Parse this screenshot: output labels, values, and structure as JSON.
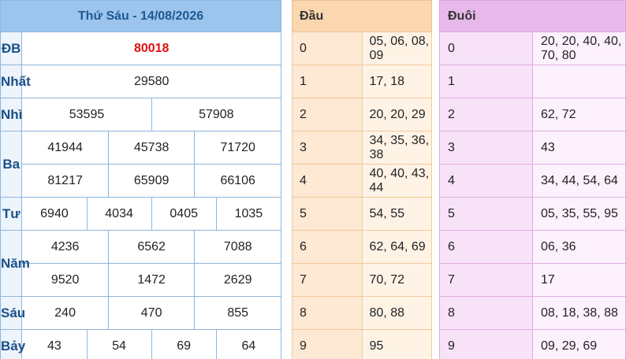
{
  "results": {
    "title": "Thứ Sáu - 14/08/2026",
    "prizes": {
      "db": {
        "label": "ĐB",
        "numbers": [
          "80018"
        ]
      },
      "nhat": {
        "label": "Nhất",
        "numbers": [
          "29580"
        ]
      },
      "nhi": {
        "label": "Nhì",
        "numbers": [
          "53595",
          "57908"
        ]
      },
      "ba": {
        "label": "Ba",
        "numbers": [
          "41944",
          "45738",
          "71720",
          "81217",
          "65909",
          "66106"
        ]
      },
      "tu": {
        "label": "Tư",
        "numbers": [
          "6940",
          "4034",
          "0405",
          "1035"
        ]
      },
      "nam": {
        "label": "Năm",
        "numbers": [
          "4236",
          "6562",
          "7088",
          "9520",
          "1472",
          "2629"
        ]
      },
      "sau": {
        "label": "Sáu",
        "numbers": [
          "240",
          "470",
          "855"
        ]
      },
      "bay": {
        "label": "Bảy",
        "numbers": [
          "43",
          "54",
          "69",
          "64"
        ]
      }
    }
  },
  "head": {
    "header": "Đầu",
    "rows": [
      {
        "key": "0",
        "values": "05, 06, 08, 09"
      },
      {
        "key": "1",
        "values": "17, 18"
      },
      {
        "key": "2",
        "values": "20, 20, 29"
      },
      {
        "key": "3",
        "values": "34, 35, 36, 38"
      },
      {
        "key": "4",
        "values": "40, 40, 43, 44"
      },
      {
        "key": "5",
        "values": "54, 55"
      },
      {
        "key": "6",
        "values": "62, 64, 69"
      },
      {
        "key": "7",
        "values": "70, 72"
      },
      {
        "key": "8",
        "values": "80, 88"
      },
      {
        "key": "9",
        "values": "95"
      }
    ]
  },
  "tail": {
    "header": "Đuôi",
    "rows": [
      {
        "key": "0",
        "values": "20, 20, 40, 40, 70, 80"
      },
      {
        "key": "1",
        "values": ""
      },
      {
        "key": "2",
        "values": "62, 72"
      },
      {
        "key": "3",
        "values": "43"
      },
      {
        "key": "4",
        "values": "34, 44, 54, 64"
      },
      {
        "key": "5",
        "values": "05, 35, 55, 95"
      },
      {
        "key": "6",
        "values": "06, 36"
      },
      {
        "key": "7",
        "values": "17"
      },
      {
        "key": "8",
        "values": "08, 18, 38, 88"
      },
      {
        "key": "9",
        "values": "09, 29, 69"
      }
    ]
  },
  "colors": {
    "special_prize": "#e01010",
    "results_header": "#9cc4ec",
    "head_header": "#fbd7b0",
    "tail_header": "#e9b8eb"
  }
}
